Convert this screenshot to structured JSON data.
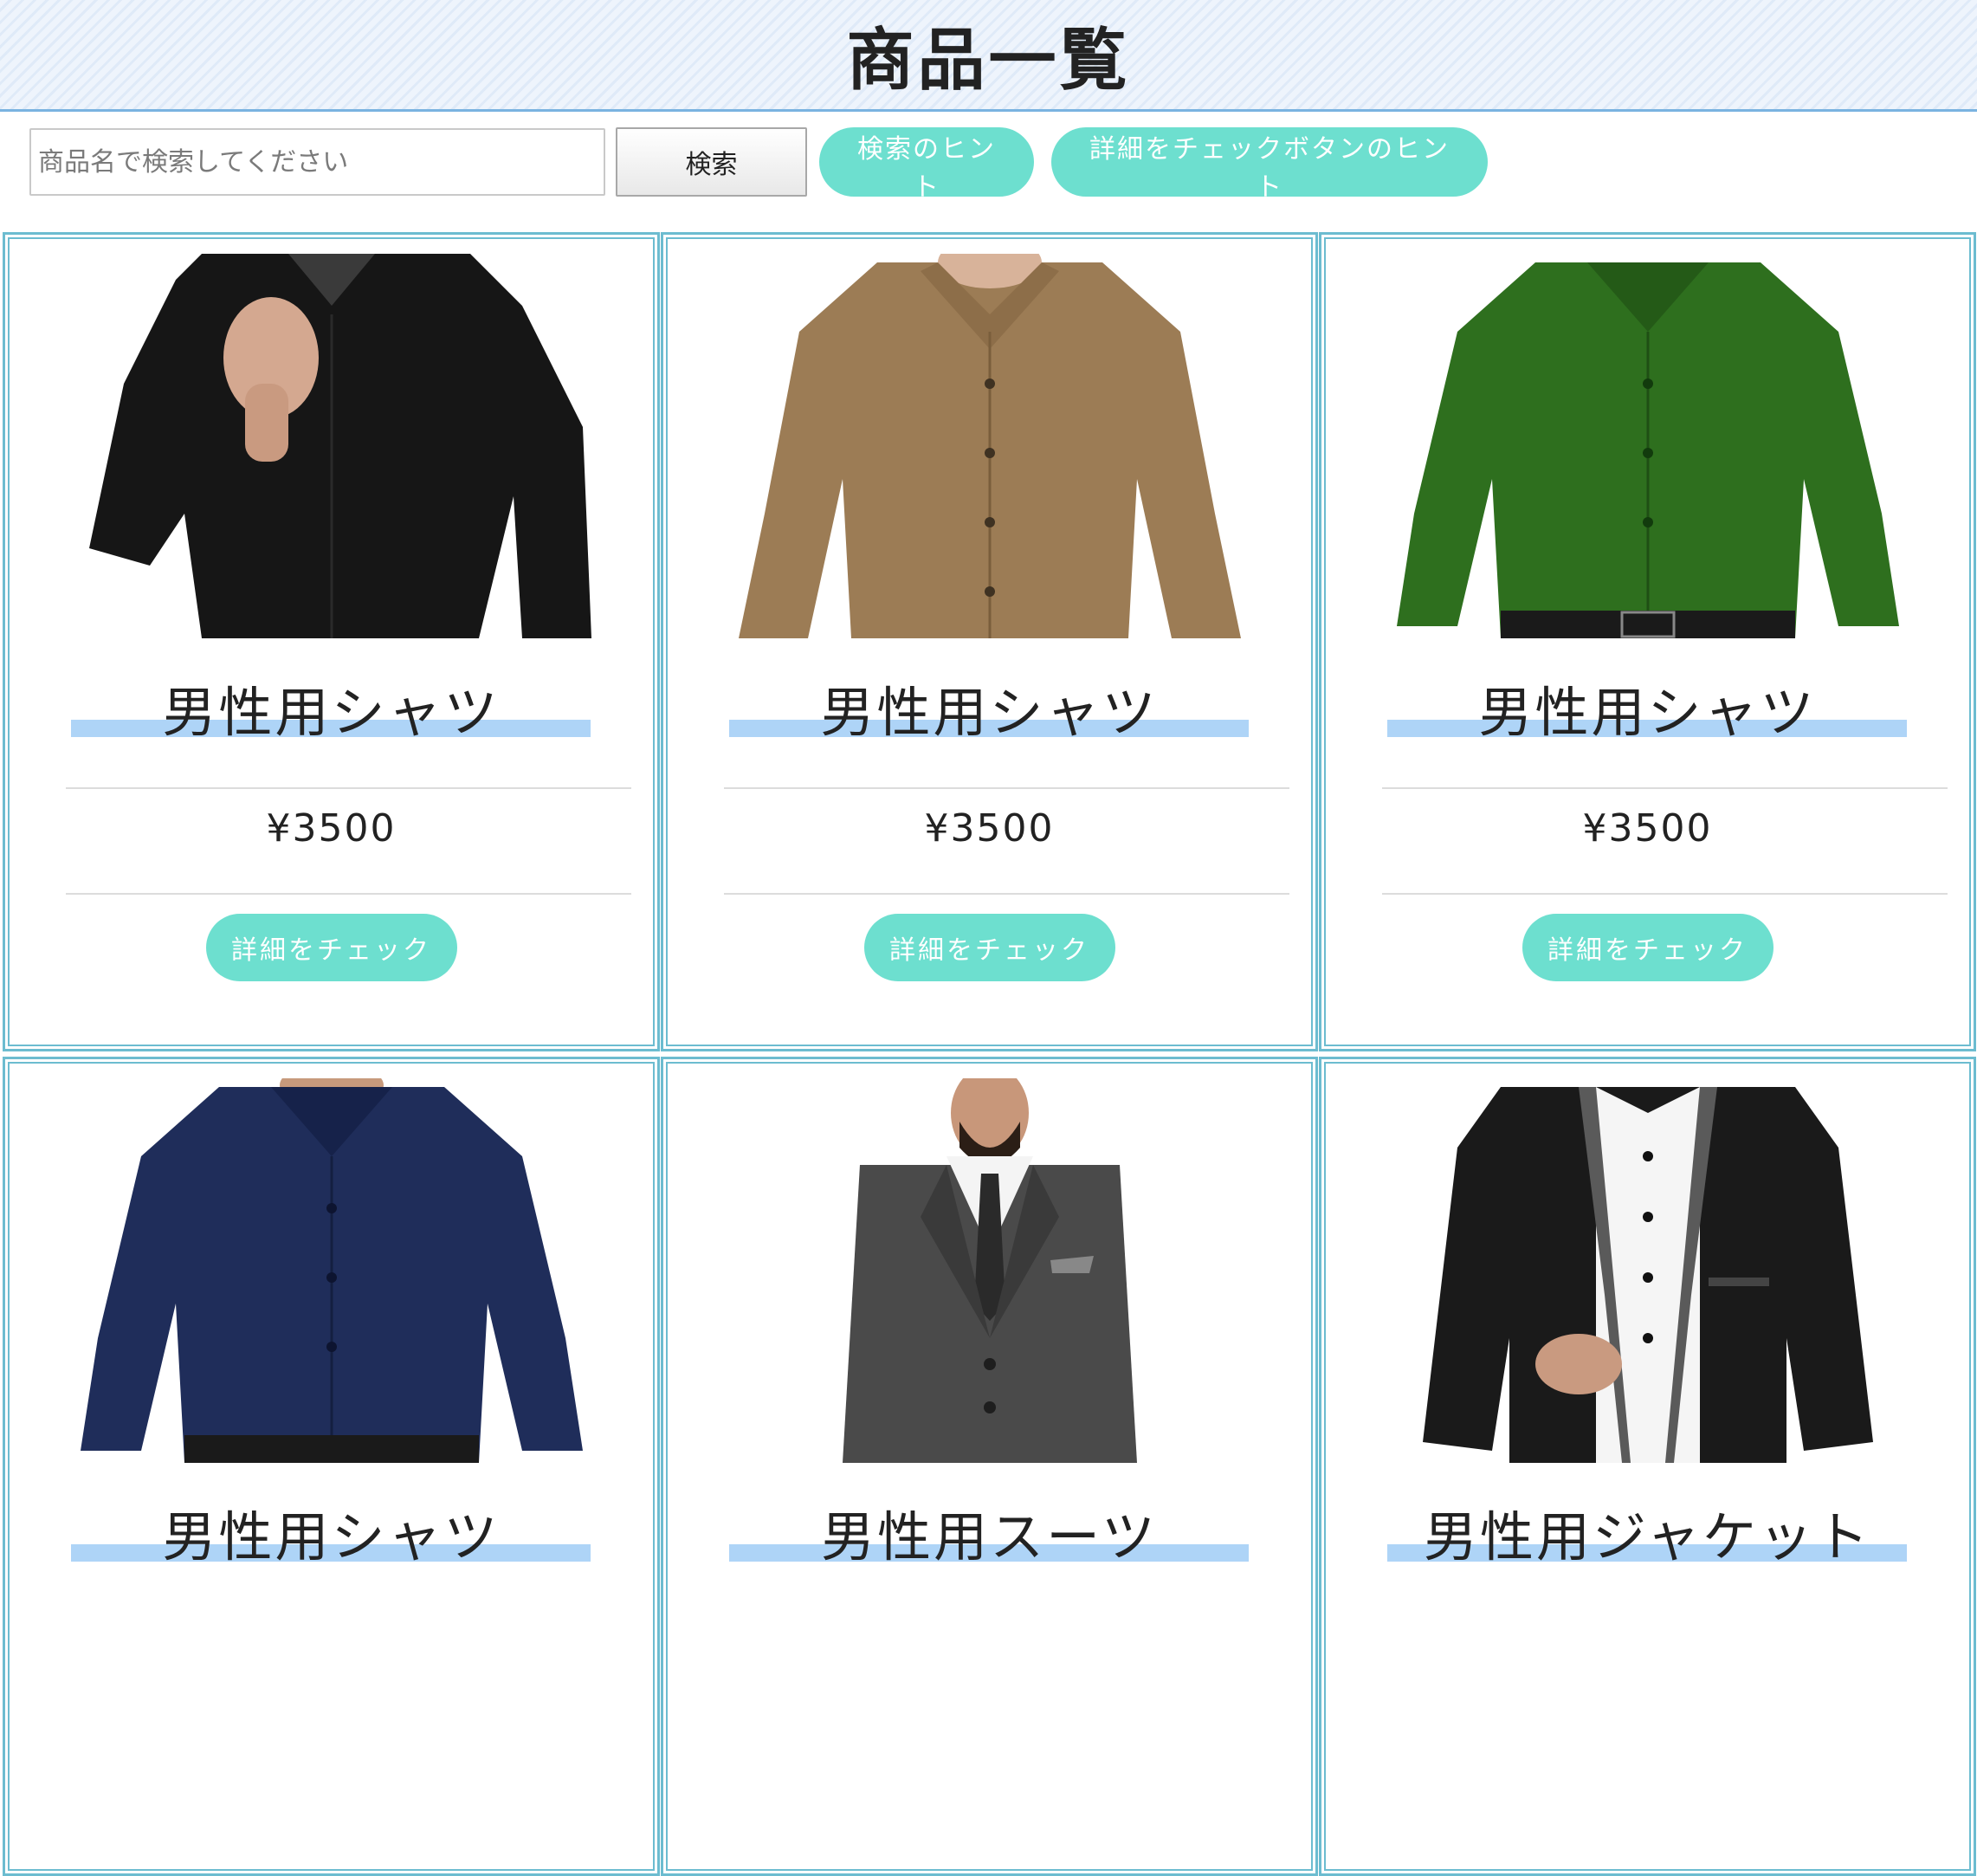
{
  "page": {
    "title": "商品一覧"
  },
  "toolbar": {
    "search_placeholder": "商品名で検索してください",
    "search_label": "検索",
    "search_hint_label": "検索のヒント",
    "detail_hint_label": "詳細をチェックボタンのヒント"
  },
  "colors": {
    "accent": "#6ddfcf",
    "card_border": "#6cbcd0",
    "title_highlight": "#aed4f7",
    "header_rule": "#7ab3e0"
  },
  "products": [
    {
      "name": "男性用シャツ",
      "price": "¥3500",
      "button": "詳細をチェック",
      "image": "black-shirt",
      "garment_color": "#161616"
    },
    {
      "name": "男性用シャツ",
      "price": "¥3500",
      "button": "詳細をチェック",
      "image": "khaki-shirt",
      "garment_color": "#9c7c55"
    },
    {
      "name": "男性用シャツ",
      "price": "¥3500",
      "button": "詳細をチェック",
      "image": "green-shirt",
      "garment_color": "#2e6f1e"
    },
    {
      "name": "男性用シャツ",
      "image": "navy-shirt",
      "garment_color": "#1f2d5a"
    },
    {
      "name": "男性用スーツ",
      "image": "gray-suit",
      "garment_color": "#4a4a4a"
    },
    {
      "name": "男性用ジャケット",
      "image": "black-jacket",
      "garment_color": "#1a1a1a"
    }
  ]
}
